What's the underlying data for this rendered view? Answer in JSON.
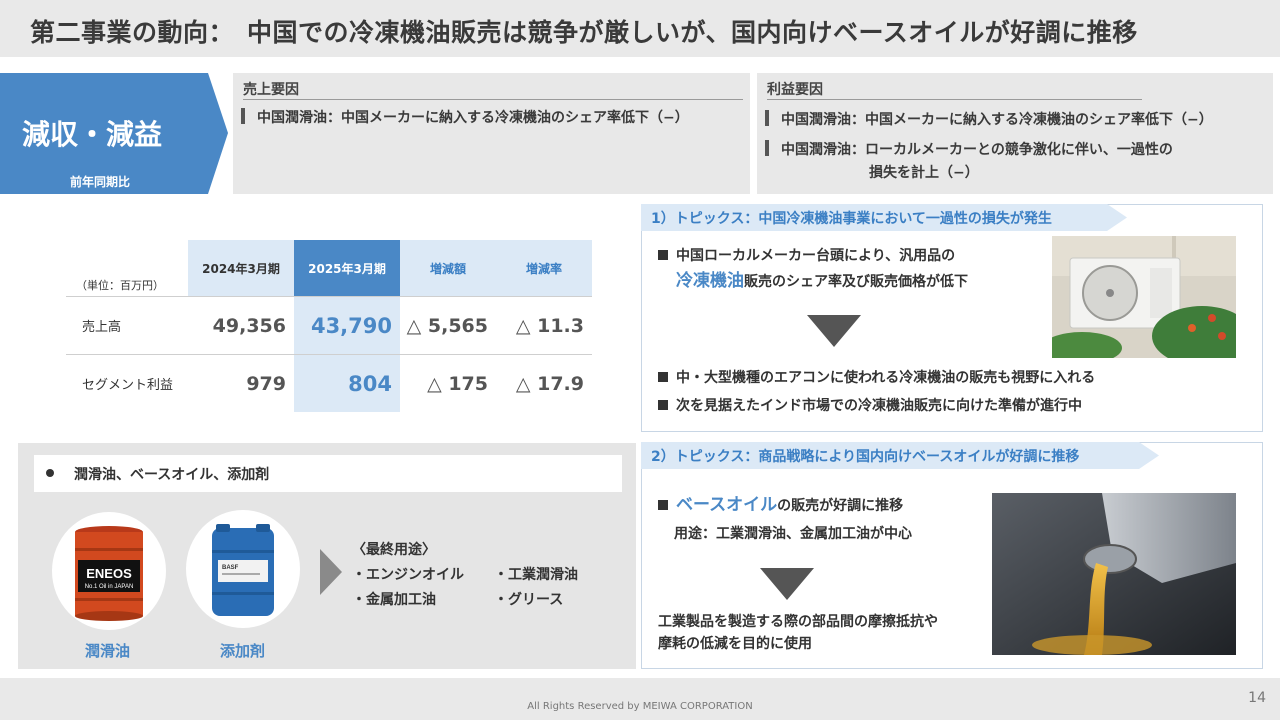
{
  "header": {
    "title": "第二事業の動向：　中国での冷凍機油販売は競争が厳しいが、国内向けベースオイルが好調に推移"
  },
  "badge": {
    "main": "減収・減益",
    "sub": "前年同期比",
    "color": "#4a88c6"
  },
  "sales_factors": {
    "heading": "売上要因",
    "items": [
      "中国潤滑油：中国メーカーに納入する冷凍機油のシェア率低下（−）"
    ]
  },
  "profit_factors": {
    "heading": "利益要因",
    "items": [
      "中国潤滑油：中国メーカーに納入する冷凍機油のシェア率低下（−）",
      "中国潤滑油：ローカルメーカーとの競争激化に伴い、一過性の"
    ],
    "item2_cont": "損失を計上（−）"
  },
  "table": {
    "unit": "（単位：百万円）",
    "headers": [
      "2024年3月期",
      "2025年3月期",
      "増減額",
      "増減率"
    ],
    "rows": [
      {
        "label": "売上高",
        "values": [
          "49,356",
          "43,790",
          "△ 5,565",
          "△ 11.3"
        ]
      },
      {
        "label": "セグメント利益",
        "values": [
          "979",
          "804",
          "△ 175",
          "△ 17.9"
        ]
      }
    ]
  },
  "products": {
    "heading": "潤滑油、ベースオイル、添加剤",
    "labels": [
      "潤滑油",
      "添加剤"
    ],
    "drum_text": [
      "ENEOS",
      "No.1 Oil in JAPAN"
    ],
    "tank_text": "BASF",
    "use_title": "〈最終用途〉",
    "uses": [
      "・エンジンオイル",
      "・工業潤滑油",
      "・金属加工油",
      "・グリース"
    ]
  },
  "topic1": {
    "tag": "1）トピックス：中国冷凍機油事業において一過性の損失が発生",
    "line1": "中国ローカルメーカー台頭により、汎用品の",
    "line2_hl": "冷凍機油",
    "line2_rest": "販売のシェア率及び販売価格が低下",
    "bullet2": "中・大型機種のエアコンに使われる冷凍機油の販売も視野に入れる",
    "bullet3": "次を見据えたインド市場での冷凍機油販売に向けた準備が進行中"
  },
  "topic2": {
    "tag": "2）トピックス：商品戦略により国内向けベースオイルが好調に推移",
    "line1_hl": "ベースオイル",
    "line1_rest": "の販売が好調に推移",
    "line2": "用途：工業潤滑油、金属加工油が中心",
    "line3": "工業製品を製造する際の部品間の摩擦抵抗や",
    "line4": "摩耗の低減を目的に使用"
  },
  "footer": {
    "copyright": "All Rights Reserved by MEIWA CORPORATION",
    "page": "14"
  }
}
